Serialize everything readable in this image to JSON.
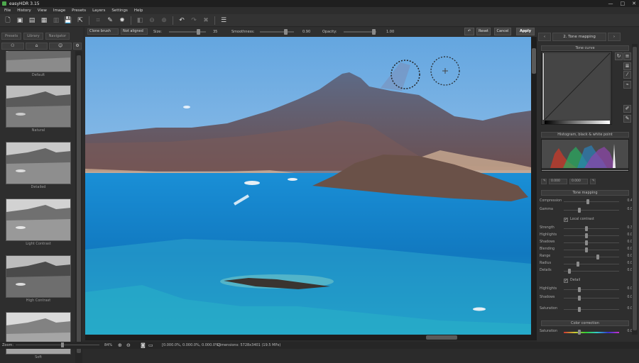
{
  "window": {
    "title": "easyHDR 3.15",
    "controls": [
      "—",
      "□",
      "✕"
    ]
  },
  "menu": [
    "File",
    "History",
    "View",
    "Image",
    "Presets",
    "Layers",
    "Settings",
    "Help"
  ],
  "options_bar": {
    "brush_mode": "Clone brush",
    "align_mode": "Not aligned",
    "size_label": "Size:",
    "size_value": "35",
    "smoothness_label": "Smoothness:",
    "smoothness_value": "0.90",
    "opacity_label": "Opacity:",
    "opacity_value": "1.00",
    "reset": "Reset",
    "cancel": "Cancel",
    "apply": "Apply"
  },
  "left_panel": {
    "tabs": [
      "Presets",
      "Library",
      "Navigator"
    ],
    "presets": [
      "Default",
      "Natural",
      "Detailed",
      "Light Contrast",
      "High Contrast",
      "Soft"
    ]
  },
  "right_panel": {
    "step_tab": "2. Tone mapping",
    "curves_header": "Tone curve",
    "histogram_header": "Histogram, black & white point",
    "hist_values": [
      "0.000",
      "0.000"
    ],
    "tone_mapping_header": "Tone mapping",
    "sliders": [
      {
        "label": "Compression",
        "value": "0.40"
      },
      {
        "label": "Gamma",
        "value": "0.00"
      }
    ],
    "local_contrast_label": "Local contrast",
    "sliders2": [
      {
        "label": "Strength",
        "value": "0.30"
      },
      {
        "label": "Highlights",
        "value": "0.00"
      },
      {
        "label": "Shadows",
        "value": "0.00"
      },
      {
        "label": "Blending",
        "value": "0.00"
      },
      {
        "label": "Range",
        "value": "0.00"
      },
      {
        "label": "Radius",
        "value": "0.00"
      },
      {
        "label": "Details",
        "value": "0.00"
      }
    ],
    "detail_label": "Detail",
    "sliders3": [
      {
        "label": "Highlights",
        "value": "0.00"
      },
      {
        "label": "Shadows",
        "value": "0.00"
      },
      {
        "label": "Saturation",
        "value": "0.00"
      }
    ],
    "color_correction_header": "Color correction",
    "sliders4": [
      {
        "label": "Saturation",
        "value": "0.00"
      }
    ]
  },
  "status": {
    "zoom_label": "Zoom:",
    "zoom_value": "84%",
    "color_info": "[0.000.0%, 0.000.0%, 0.000.0%]",
    "dimensions": "Dimensions: 5728x3401 (19.5 MPx)"
  }
}
